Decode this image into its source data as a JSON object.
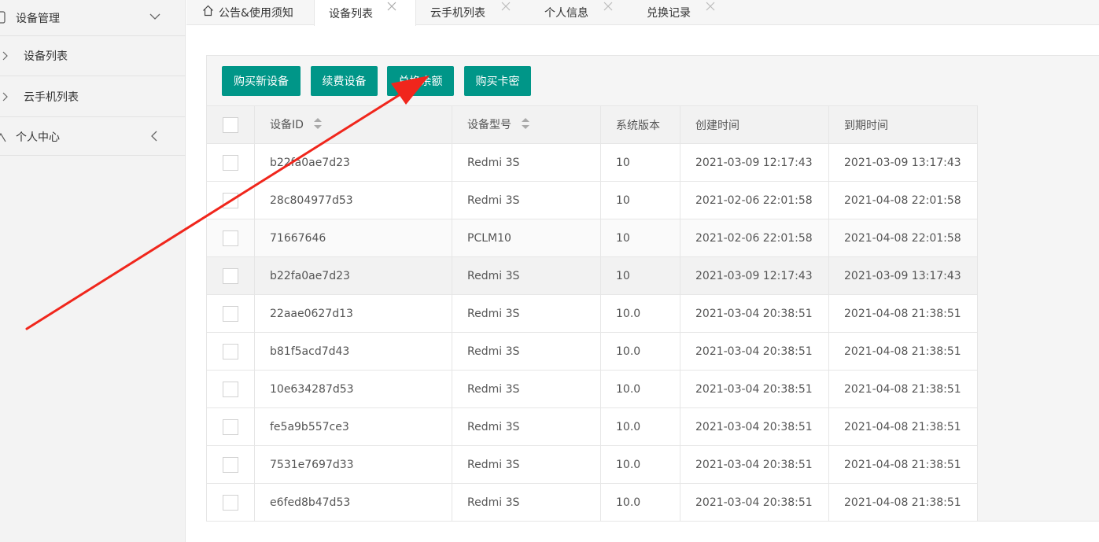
{
  "sidebar": {
    "groups": [
      {
        "label": "设备管理",
        "expanded": true,
        "items": [
          {
            "label": "设备列表"
          },
          {
            "label": "云手机列表"
          }
        ]
      },
      {
        "label": "个人中心",
        "expanded": false
      }
    ]
  },
  "tabs": [
    {
      "label": "公告&使用须知",
      "icon": "home-icon"
    },
    {
      "label": "设备列表",
      "active": true,
      "closable": true
    },
    {
      "label": "云手机列表",
      "closable": true
    },
    {
      "label": "个人信息",
      "closable": true
    },
    {
      "label": "兑换记录",
      "closable": true
    }
  ],
  "toolbar": {
    "buy_new": "购买新设备",
    "renew": "续费设备",
    "redeem_balance": "兑换余额",
    "buy_card": "购买卡密",
    "accent_color": "#009688"
  },
  "table": {
    "headers": {
      "device_id": "设备ID",
      "model": "设备型号",
      "os_version": "系统版本",
      "created": "创建时间",
      "expires": "到期时间"
    },
    "rows": [
      {
        "device_id": "b22fa0ae7d23",
        "model": "Redmi 3S",
        "os_version": "10",
        "created": "2021-03-09 12:17:43",
        "expires": "2021-03-09 13:17:43"
      },
      {
        "device_id": "28c804977d53",
        "model": "Redmi 3S",
        "os_version": "10",
        "created": "2021-02-06 22:01:58",
        "expires": "2021-04-08 22:01:58"
      },
      {
        "device_id": "71667646",
        "model": "PCLM10",
        "os_version": "10",
        "created": "2021-02-06 22:01:58",
        "expires": "2021-04-08 22:01:58"
      },
      {
        "device_id": "b22fa0ae7d23",
        "model": "Redmi 3S",
        "os_version": "10",
        "created": "2021-03-09 12:17:43",
        "expires": "2021-03-09 13:17:43"
      },
      {
        "device_id": "22aae0627d13",
        "model": "Redmi 3S",
        "os_version": "10.0",
        "created": "2021-03-04 20:38:51",
        "expires": "2021-04-08 21:38:51"
      },
      {
        "device_id": "b81f5acd7d43",
        "model": "Redmi 3S",
        "os_version": "10.0",
        "created": "2021-03-04 20:38:51",
        "expires": "2021-04-08 21:38:51"
      },
      {
        "device_id": "10e634287d53",
        "model": "Redmi 3S",
        "os_version": "10.0",
        "created": "2021-03-04 20:38:51",
        "expires": "2021-04-08 21:38:51"
      },
      {
        "device_id": "fe5a9b557ce3",
        "model": "Redmi 3S",
        "os_version": "10.0",
        "created": "2021-03-04 20:38:51",
        "expires": "2021-04-08 21:38:51"
      },
      {
        "device_id": "7531e7697d33",
        "model": "Redmi 3S",
        "os_version": "10.0",
        "created": "2021-03-04 20:38:51",
        "expires": "2021-04-08 21:38:51"
      },
      {
        "device_id": "e6fed8b47d53",
        "model": "Redmi 3S",
        "os_version": "10.0",
        "created": "2021-03-04 20:38:51",
        "expires": "2021-04-08 21:38:51"
      }
    ]
  },
  "annotation": {
    "icon": "red-arrow",
    "color": "#f0261c"
  }
}
